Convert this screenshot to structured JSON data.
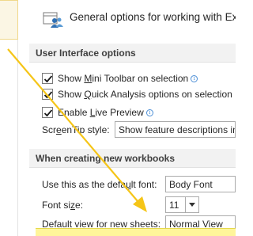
{
  "header": {
    "title": "General options for working with Exc",
    "icon": "general-options-icon"
  },
  "ui_section": {
    "title": "User Interface options",
    "mini_toolbar": {
      "label_pre": "Show ",
      "label_u": "M",
      "label_post": "ini Toolbar on selection",
      "checked": true
    },
    "quick_analysis": {
      "label_pre": "Show ",
      "label_u": "Q",
      "label_post": "uick Analysis options on selection",
      "checked": true
    },
    "live_preview": {
      "label_pre": "Enable ",
      "label_u": "L",
      "label_post": "ive Preview",
      "checked": true
    },
    "screentip": {
      "label_pre": "Scr",
      "label_u": "e",
      "label_post": "enTip style:",
      "value": "Show feature descriptions in"
    }
  },
  "workbook_section": {
    "title": "When creating new workbooks",
    "default_font": {
      "label_pre": "Use this as the defa",
      "label_u": "u",
      "label_post": "lt font:",
      "value": "Body Font"
    },
    "font_size": {
      "label_pre": "Font si",
      "label_u": "z",
      "label_post": "e:",
      "value": "11"
    },
    "default_view": {
      "label_pre": "Default ",
      "label_u": "v",
      "label_post": "iew for new sheets:",
      "value": "Normal View"
    }
  },
  "colors": {
    "arrow": "#f5c518",
    "highlight": "#fff59a",
    "checkmark": "#1a1a1a"
  }
}
